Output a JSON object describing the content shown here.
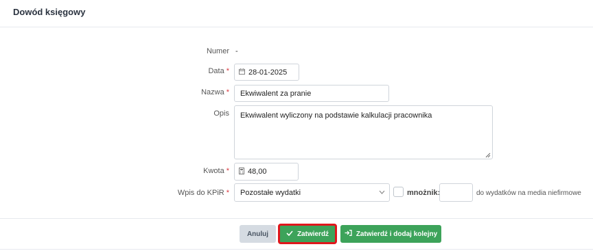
{
  "header": {
    "title": "Dowód księgowy"
  },
  "form": {
    "numer": {
      "label": "Numer",
      "value": "-"
    },
    "data": {
      "label": "Data",
      "required_mark": "*",
      "value": "28-01-2025",
      "icon": "calendar-icon"
    },
    "nazwa": {
      "label": "Nazwa",
      "required_mark": "*",
      "value": "Ekwiwalent za pranie"
    },
    "opis": {
      "label": "Opis",
      "value": "Ekwiwalent wyliczony na podstawie kalkulacji pracownika"
    },
    "kwota": {
      "label": "Kwota",
      "required_mark": "*",
      "value": "48,00",
      "icon": "calculator-icon"
    },
    "wpis": {
      "label": "Wpis do KPiR",
      "required_mark": "*",
      "selected": "Pozostałe wydatki",
      "multiplier_label": "mnożnik:",
      "multiplier_value": "",
      "note": "do wydatków na media niefirmowe"
    }
  },
  "buttons": {
    "cancel": "Anuluj",
    "confirm": "Zatwierdź",
    "confirm_next": "Zatwierdź i dodaj kolejny"
  },
  "colors": {
    "accent_green": "#3da35a",
    "highlight_red": "#e0161c",
    "required_red": "#d9363e"
  }
}
